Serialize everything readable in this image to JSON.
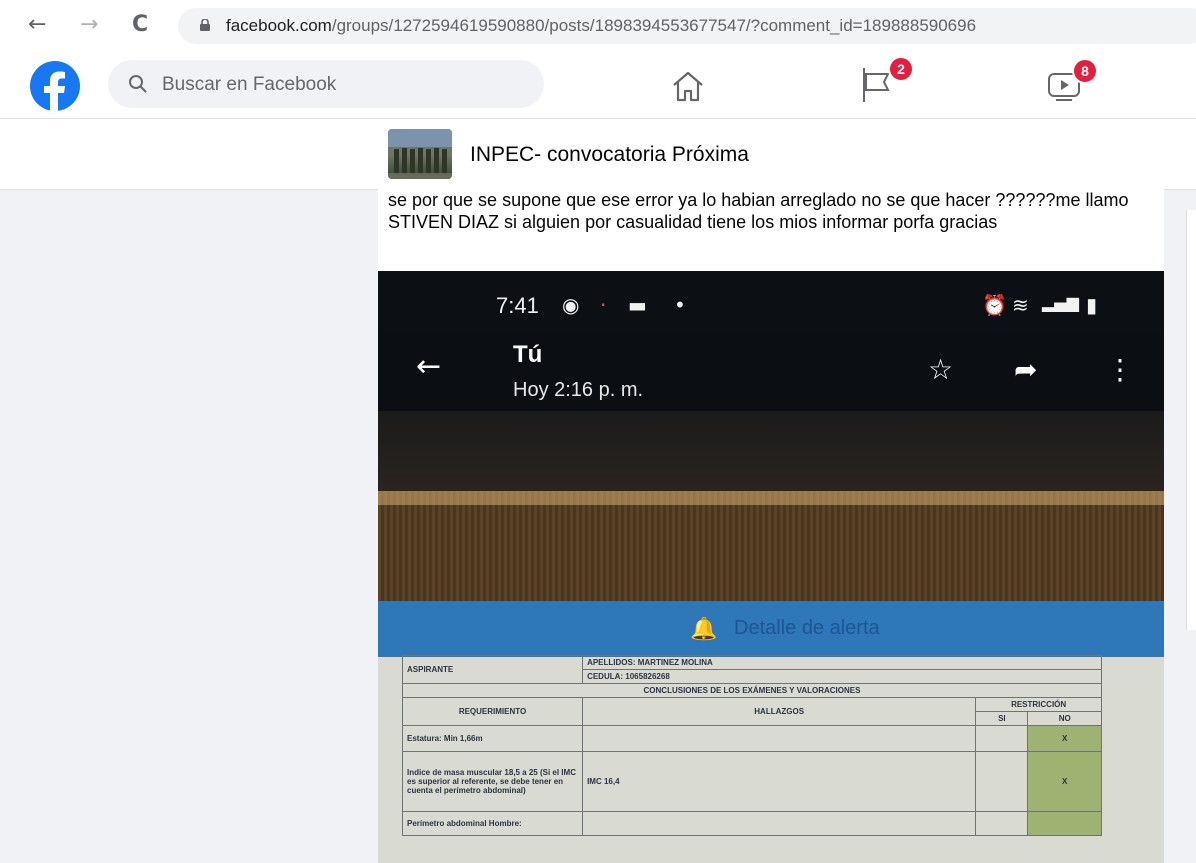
{
  "browser": {
    "back": "←",
    "forward": "→",
    "reload": "C",
    "url_domain": "facebook.com",
    "url_rest": "/groups/1272594619590880/posts/1898394553677547/?comment_id=189888590696"
  },
  "fb": {
    "search_placeholder": "Buscar en Facebook",
    "badges": {
      "notifications": "2",
      "watch": "8"
    }
  },
  "group": {
    "name": "INPEC- convocatoria Próxima"
  },
  "post": {
    "text": "se por que se supone que ese error ya lo habian arreglado no se que hacer ??????me llamo STIVEN DIAZ si alguien por casualidad tiene los mios informar porfa gracias"
  },
  "photo": {
    "status_time": "7:41",
    "contact": "Tú",
    "timestamp": "Hoy 2:16 p. m.",
    "banner": "Detalle de alerta",
    "doc": {
      "aspirante_label": "ASPIRANTE",
      "apellidos": "APELLIDOS: MARTINEZ MOLINA",
      "cedula": "CEDULA: 1065826268",
      "conclusiones": "CONCLUSIONES DE LOS EXÁMENES Y VALORACIONES",
      "col_requerimiento": "REQUERIMIENTO",
      "col_hallazgos": "HALLAZGOS",
      "col_restriccion": "RESTRICCIÓN",
      "col_si": "SI",
      "col_no": "NO",
      "rows": [
        {
          "req": "Estatura: Min 1,66m",
          "hall": "",
          "no": "X"
        },
        {
          "req": "Indice de masa muscular 18,5 a 25 (Si el IMC es superior al referente, se debe tener en cuenta el perímetro abdominal)",
          "hall": "IMC 16,4",
          "no": "X"
        },
        {
          "req": "Perímetro abdominal Hombre:",
          "hall": "",
          "no": ""
        }
      ]
    }
  },
  "colors": {
    "fb_blue": "#1877f2",
    "badge_red": "#e41e3f"
  }
}
